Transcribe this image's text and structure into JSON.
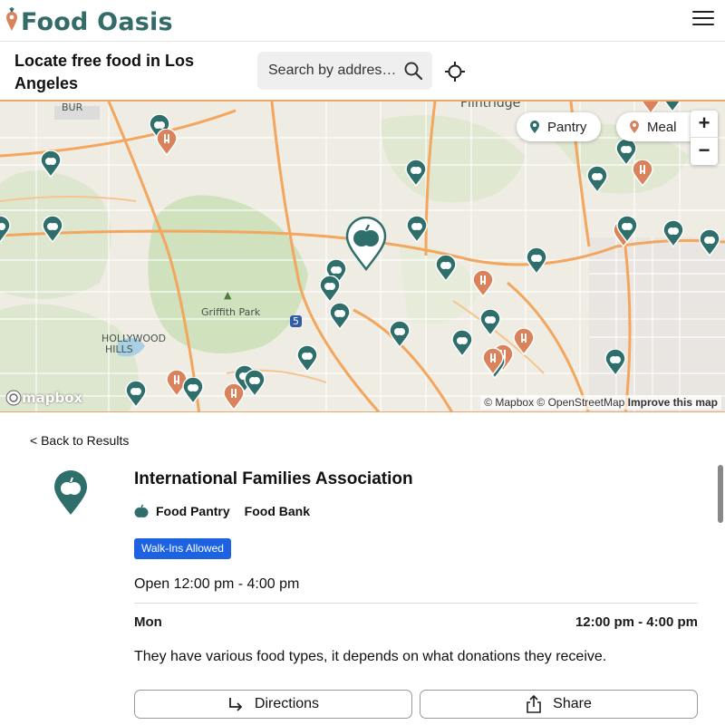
{
  "header": {
    "logo_text": "Food Oasis",
    "logo_icon": "carrot-pin-icon",
    "menu_icon": "hamburger-menu-icon"
  },
  "search": {
    "headline": "Locate free food in Los Angeles",
    "placeholder": "Search by address",
    "display_value": "Search by addres…"
  },
  "map": {
    "legend": [
      {
        "label": "Pantry",
        "color": "#2f6f6b",
        "icon": "pantry-pin-icon"
      },
      {
        "label": "Meal",
        "color": "#d9825b",
        "icon": "meal-pin-icon"
      }
    ],
    "zoom_in": "+",
    "zoom_out": "−",
    "labels": {
      "griffith": "Griffith Park",
      "hollywood": "HOLLYWOOD",
      "hills": "HILLS",
      "bur": "BUR",
      "flintridge": "Flintridge",
      "freeway": "5"
    },
    "attribution": {
      "text": "© Mapbox © OpenStreetMap",
      "improve": "Improve this map"
    },
    "provider": "mapbox"
  },
  "detail": {
    "back_label": "< Back to Results",
    "name": "International Families Association",
    "categories": [
      "Food Pantry",
      "Food Bank"
    ],
    "badge": "Walk-Ins Allowed",
    "open_status": "Open 12:00 pm - 4:00 pm",
    "schedule": [
      {
        "day": "Mon",
        "hours": "12:00 pm - 4:00 pm"
      }
    ],
    "notes": "They have various food types, it depends on what donations they receive.",
    "directions_label": "Directions",
    "share_label": "Share"
  },
  "colors": {
    "brand": "#336b68",
    "pantry": "#2f6f6b",
    "meal": "#d9825b",
    "badge": "#1d62e0",
    "map_border": "#e9a86b"
  }
}
